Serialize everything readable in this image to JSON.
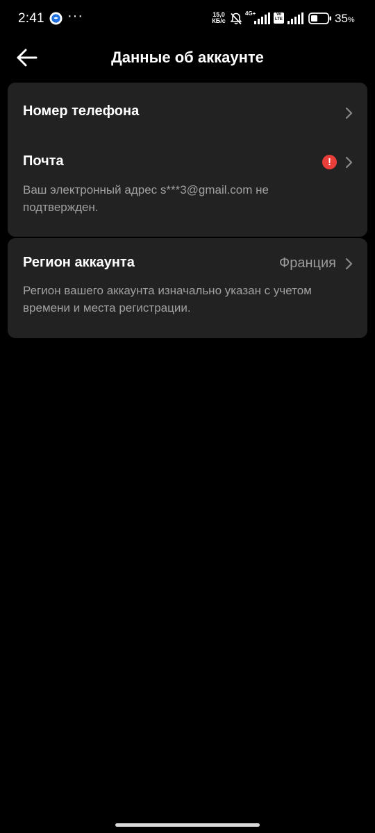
{
  "status_bar": {
    "time": "2:41",
    "dots": "···",
    "speed_value": "15,0",
    "speed_unit": "КБ/с",
    "network": "4G+",
    "volte": "Vo LTE",
    "battery_percent": "35",
    "battery_percent_sign": "%"
  },
  "header": {
    "title": "Данные об аккаунте"
  },
  "phone_row": {
    "label": "Номер телефона"
  },
  "email_row": {
    "label": "Почта",
    "warning_symbol": "!",
    "description": "Ваш электронный адрес s***3@gmail.com не подтвержден."
  },
  "region_row": {
    "label": "Регион аккаунта",
    "value": "Франция",
    "description": "Регион вашего аккаунта изначально указан с учетом времени и места регистрации."
  },
  "colors": {
    "background": "#000000",
    "card": "#222222",
    "warning": "#ea3e3a",
    "secondary_text": "#a0a0a0"
  },
  "icons": [
    "back-arrow-icon",
    "chevron-right-icon",
    "warning-icon",
    "mute-icon",
    "signal-icon",
    "battery-icon"
  ]
}
